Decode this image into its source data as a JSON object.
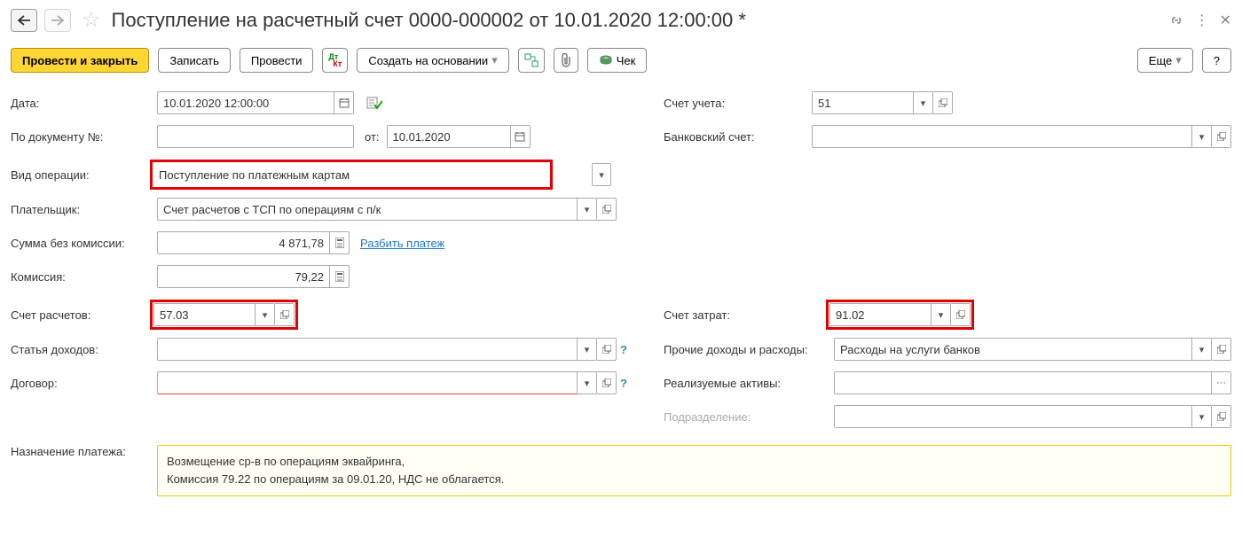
{
  "header": {
    "title": "Поступление на расчетный счет 0000-000002 от 10.01.2020 12:00:00 *"
  },
  "toolbar": {
    "post_close": "Провести и закрыть",
    "save": "Записать",
    "post": "Провести",
    "create_based": "Создать на основании",
    "check": "Чек",
    "more": "Еще",
    "help": "?"
  },
  "labels": {
    "date": "Дата:",
    "doc_no": "По документу №:",
    "from": "от:",
    "op_type": "Вид операции:",
    "payer": "Плательщик:",
    "sum_no_comm": "Сумма без комиссии:",
    "commission": "Комиссия:",
    "settlement_acc": "Счет расчетов:",
    "income_item": "Статья доходов:",
    "contract": "Договор:",
    "purpose": "Назначение платежа:",
    "account": "Счет учета:",
    "bank_acc": "Банковский счет:",
    "expense_acc": "Счет затрат:",
    "other_income": "Прочие доходы и расходы:",
    "assets": "Реализуемые активы:",
    "division": "Подразделение:"
  },
  "values": {
    "date": "10.01.2020 12:00:00",
    "doc_no": "",
    "from_date": "10.01.2020",
    "op_type": "Поступление по платежным картам",
    "payer": "Счет расчетов с ТСП по операциям с п/к",
    "sum_no_comm": "4 871,78",
    "commission": "79,22",
    "settlement_acc": "57.03",
    "income_item": "",
    "contract": "",
    "account": "51",
    "bank_acc": "",
    "expense_acc": "91.02",
    "other_income": "Расходы на услуги банков",
    "assets": "",
    "division": "",
    "purpose_l1": "Возмещение ср-в по операциям эквайринга,",
    "purpose_l2": "Комиссия 79.22 по операциям за 09.01.20, НДС не облагается."
  },
  "links": {
    "split": "Разбить платеж"
  }
}
